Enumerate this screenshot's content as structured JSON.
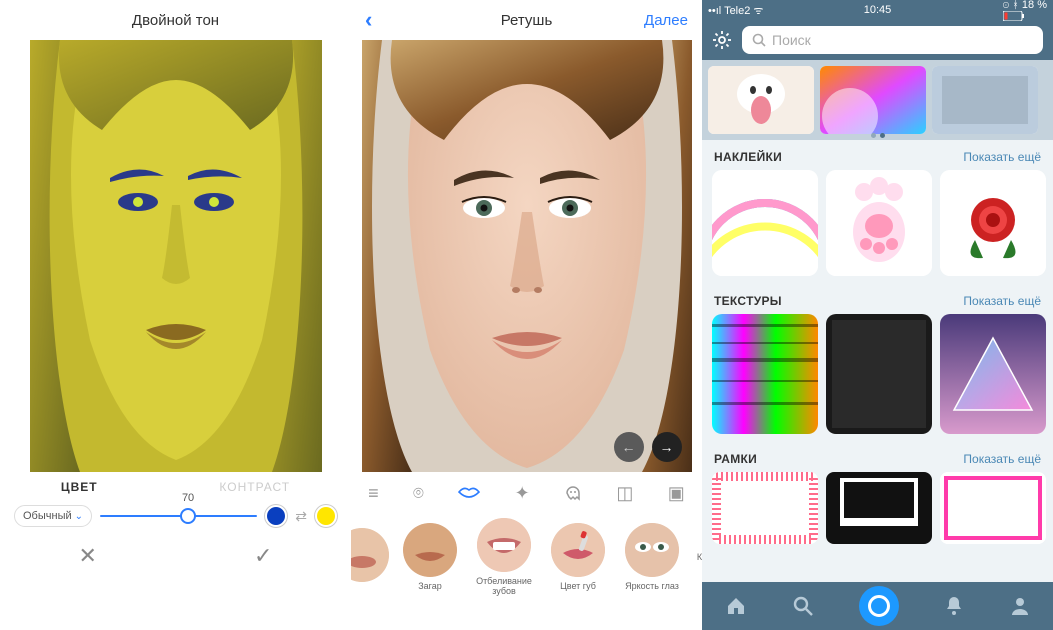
{
  "panel1": {
    "title": "Двойной тон",
    "tabs": {
      "color": "ЦВЕТ",
      "contrast": "КОНТРАСТ"
    },
    "mode_pill": "Обычный",
    "slider_value": "70",
    "swatch_a": "#0a3fbf",
    "swatch_b": "#ffe600"
  },
  "panel2": {
    "title": "Ретушь",
    "next": "Далее",
    "tools": {
      "t1": "adjust",
      "t2": "filters",
      "t3": "lips",
      "t4": "sparkle",
      "t5": "ghost",
      "t6": "crop",
      "t7": "frame"
    },
    "thumbs": [
      {
        "label": "Загар"
      },
      {
        "label": "Отбеливание зубов"
      },
      {
        "label": "Цвет губ"
      },
      {
        "label": "Яркость глаз"
      },
      {
        "label": "Кр"
      }
    ]
  },
  "panel3": {
    "status": {
      "carrier": "Tele2",
      "time": "10:45",
      "battery": "18 %"
    },
    "search_placeholder": "Поиск",
    "sections": {
      "stickers": {
        "title": "НАКЛЕЙКИ",
        "more": "Показать ещё"
      },
      "textures": {
        "title": "ТЕКСТУРЫ",
        "more": "Показать ещё"
      },
      "frames": {
        "title": "РАМКИ",
        "more": "Показать ещё"
      }
    }
  }
}
